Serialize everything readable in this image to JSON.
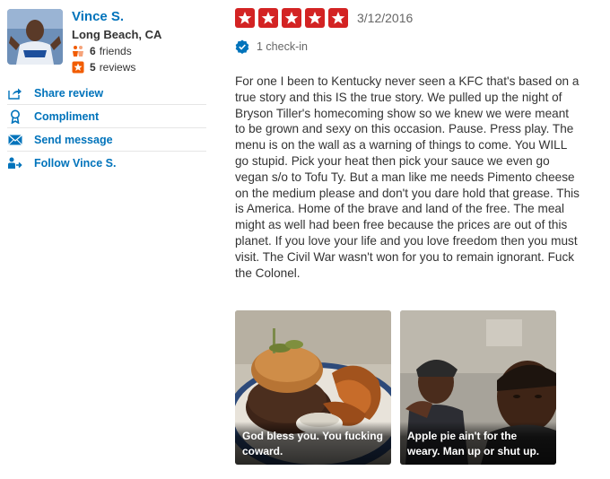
{
  "user": {
    "name": "Vince S.",
    "location": "Long Beach, CA",
    "friends_count": "6",
    "friends_label": "friends",
    "reviews_count": "5",
    "reviews_label": "reviews"
  },
  "actions": {
    "share": "Share review",
    "compliment": "Compliment",
    "message": "Send message",
    "follow": "Follow Vince S."
  },
  "review": {
    "rating": 5,
    "date": "3/12/2016",
    "checkin": "1 check-in",
    "text": "For one I been to Kentucky never seen a KFC that's based on a true story and this IS the true story. We pulled up the night of Bryson Tiller's homecoming show so we knew we were meant to be grown and sexy on this occasion. Pause. Press play. The menu is on the wall as a warning of things to come. You WILL go stupid. Pick your heat then pick your sauce we even go vegan s/o to Tofu Ty. But a man like me needs Pimento cheese on the medium please and don't you dare hold that grease. This is America. Home of the brave and land of the free. The meal might as well had been free because the prices are out of this planet. If you love your life and you love freedom then you must visit. The Civil War wasn't won for you to remain ignorant. Fuck the Colonel."
  },
  "photos": [
    {
      "caption": "God bless you. You fucking coward."
    },
    {
      "caption": "Apple pie ain't for the weary. Man up or shut up."
    }
  ],
  "colors": {
    "link": "#0073bb",
    "star_red": "#d32323",
    "checkin_blue": "#0073bb"
  },
  "icons": [
    "share-icon",
    "compliment-icon",
    "message-icon",
    "follow-icon",
    "friends-icon",
    "reviews-icon",
    "checkin-icon",
    "star-icon"
  ]
}
